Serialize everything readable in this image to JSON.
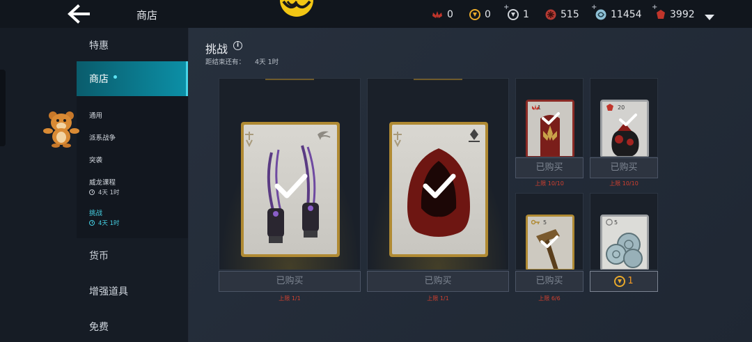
{
  "header": {
    "title": "商店",
    "currencies": [
      {
        "icon": "lotus-icon",
        "value": "0",
        "color": "#c0352b"
      },
      {
        "icon": "gold-emblem-icon",
        "value": "0",
        "color": "#e8a92b"
      },
      {
        "icon": "silver-emblem-icon",
        "value": "1",
        "color": "#cfd3d8"
      },
      {
        "icon": "red-orb-icon",
        "value": "515",
        "color": "#b53a33"
      },
      {
        "icon": "swirl-icon",
        "value": "11454",
        "color": "#8fc1d6"
      },
      {
        "icon": "red-gem-icon",
        "value": "3992",
        "color": "#c0352b"
      }
    ]
  },
  "sidebar": {
    "items": [
      {
        "label": "特惠"
      },
      {
        "label": "商店"
      },
      {
        "label": "货币"
      },
      {
        "label": "增强道具"
      },
      {
        "label": "免费"
      }
    ],
    "sub_items": [
      {
        "label": "通用"
      },
      {
        "label": "派系战争"
      },
      {
        "label": "突袭"
      },
      {
        "label": "威龙课程",
        "time": "4天 1时"
      },
      {
        "label": "挑战",
        "time": "4天 1时"
      }
    ]
  },
  "main": {
    "title": "挑战",
    "countdown_label": "距结束还有：",
    "countdown_value": "4天 1时",
    "items": [
      {
        "name": "claws",
        "button": "已购买",
        "limit": "上限 1/1"
      },
      {
        "name": "red-hood",
        "button": "已购买",
        "limit": "上限 1/1"
      },
      {
        "name": "lotus-banner",
        "qty": "1",
        "button": "已购买",
        "limit": "上限 10/10"
      },
      {
        "name": "red-sack",
        "qty": "20",
        "button": "已购买",
        "limit": "上限 10/10"
      },
      {
        "name": "hammer",
        "qty": "5",
        "button": "已购买",
        "limit": "上限 6/6"
      },
      {
        "name": "silver-coins",
        "qty": "5",
        "price": "1"
      }
    ]
  }
}
